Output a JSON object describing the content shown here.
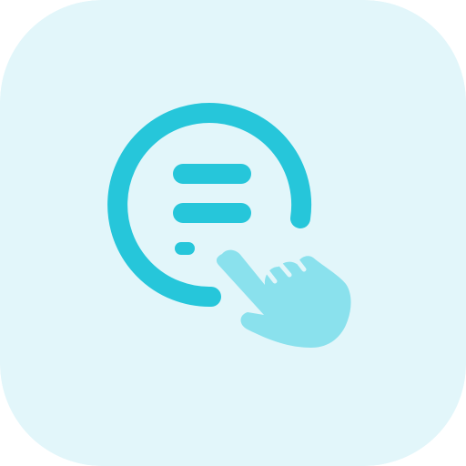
{
  "icon": {
    "name": "tap-menu-icon",
    "tile_color": "#E2F6FA",
    "primary_color": "#26C6DA",
    "accent_color": "#8AE1ED"
  }
}
